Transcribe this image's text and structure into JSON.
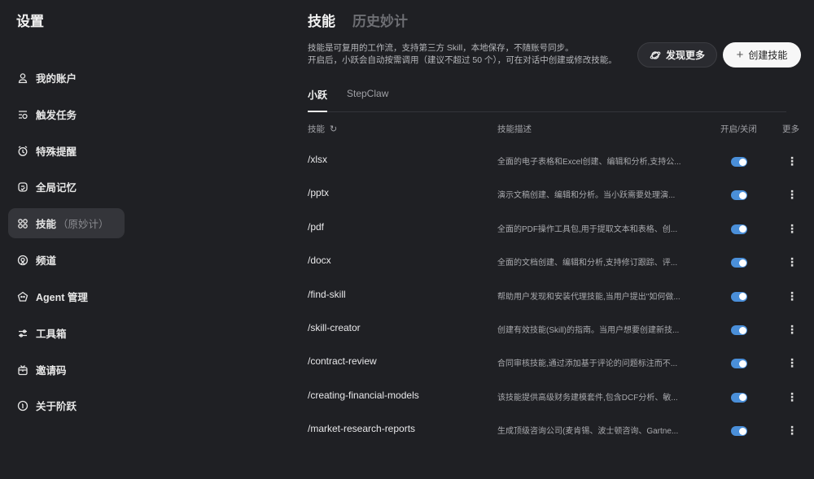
{
  "sidebar": {
    "title": "设置",
    "items": [
      {
        "label": "我的账户",
        "icon": "user-icon"
      },
      {
        "label": "触发任务",
        "icon": "trigger-task-icon"
      },
      {
        "label": "特殊提醒",
        "icon": "alarm-clock-icon"
      },
      {
        "label": "全局记忆",
        "icon": "memory-icon"
      },
      {
        "label": "技能",
        "sub": "（原妙计）",
        "icon": "grid-icon",
        "active": true
      },
      {
        "label": "频道",
        "icon": "channel-icon"
      },
      {
        "label": "Agent 管理",
        "icon": "agent-icon"
      },
      {
        "label": "工具箱",
        "icon": "sliders-icon"
      },
      {
        "label": "邀请码",
        "icon": "gift-icon"
      },
      {
        "label": "关于阶跃",
        "icon": "info-icon"
      }
    ]
  },
  "main": {
    "tabs": [
      {
        "label": "技能",
        "active": true
      },
      {
        "label": "历史妙计"
      }
    ],
    "description_line1": "技能是可复用的工作流，支持第三方 Skill，本地保存，不随账号同步。",
    "description_line2": "开启后，小跃会自动按需调用（建议不超过 50 个），可在对话中创建或修改技能。",
    "discover_label": "发现更多",
    "create_label": "创建技能",
    "subtabs": [
      {
        "label": "小跃",
        "active": true
      },
      {
        "label": "StepClaw"
      }
    ],
    "columns": {
      "skill": "技能",
      "description": "技能描述",
      "toggle": "开启/关闭",
      "more": "更多"
    },
    "toggle_color": "#4a8fd9",
    "rows": [
      {
        "name": "/xlsx",
        "desc": "全面的电子表格和Excel创建、编辑和分析,支持公...",
        "enabled": true
      },
      {
        "name": "/pptx",
        "desc": "演示文稿创建、编辑和分析。当小跃需要处理演...",
        "enabled": true
      },
      {
        "name": "/pdf",
        "desc": "全面的PDF操作工具包,用于提取文本和表格、创...",
        "enabled": true
      },
      {
        "name": "/docx",
        "desc": "全面的文档创建、编辑和分析,支持修订跟踪、评...",
        "enabled": true
      },
      {
        "name": "/find-skill",
        "desc": "帮助用户发现和安装代理技能,当用户提出\"如何做...",
        "enabled": true
      },
      {
        "name": "/skill-creator",
        "desc": "创建有效技能(Skill)的指南。当用户想要创建新技...",
        "enabled": true
      },
      {
        "name": "/contract-review",
        "desc": "合同审核技能,通过添加基于评论的问题标注而不...",
        "enabled": true
      },
      {
        "name": "/creating-financial-models",
        "desc": "该技能提供高级财务建模套件,包含DCF分析、敏...",
        "enabled": true
      },
      {
        "name": "/market-research-reports",
        "desc": "生成顶级咨询公司(麦肯锡、波士顿咨询、Gartne...",
        "enabled": true
      }
    ]
  }
}
